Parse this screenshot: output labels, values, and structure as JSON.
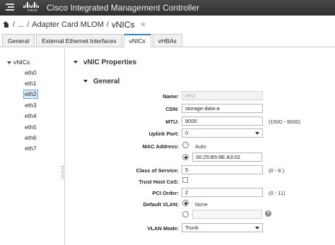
{
  "app": {
    "brand": "cisco",
    "title": "Cisco Integrated Management Controller"
  },
  "breadcrumb": {
    "ellipsis": "...",
    "separator": "/",
    "parent": "Adapter Card MLOM",
    "current": "vNICs"
  },
  "tabs": [
    "General",
    "External Ethernet Interfaces",
    "vNICs",
    "vHBAs"
  ],
  "tree": {
    "root": "vNICs",
    "items": [
      "eth0",
      "eth1",
      "eth2",
      "eth3",
      "eth4",
      "eth5",
      "eth6",
      "eth7"
    ],
    "selected": "eth2"
  },
  "section": {
    "title": "vNIC Properties",
    "subtitle": "General"
  },
  "form": {
    "name": {
      "label": "Name:",
      "value": "eth2"
    },
    "cdn": {
      "label": "CDN:",
      "value": "storage-data-a"
    },
    "mtu": {
      "label": "MTU:",
      "value": "9000",
      "hint": "(1500 - 9000)"
    },
    "uplink_port": {
      "label": "Uplink Port:",
      "value": "0"
    },
    "mac_address": {
      "label": "MAC Address:",
      "auto_label": "Auto",
      "value": "00:25:B5:8E:A3:02"
    },
    "class_of_service": {
      "label": "Class of Service:",
      "value": "5",
      "hint": "(0 - 6 )"
    },
    "trust_host_cos": {
      "label": "Trust Host CoS:",
      "checked": false
    },
    "pci_order": {
      "label": "PCI Order:",
      "value": "2",
      "hint": "(0 - 11)"
    },
    "default_vlan": {
      "label": "Default VLAN:",
      "none_label": "None",
      "value": ""
    },
    "vlan_mode": {
      "label": "VLAN Mode:",
      "value": "Trunk"
    }
  },
  "colors": {
    "accent": "#2a8ad3",
    "topbar": "#3a3a3a",
    "selected_bg": "#d8ecf8"
  },
  "icons": [
    "menu-icon",
    "cisco-logo",
    "home-icon",
    "star-icon",
    "help-icon"
  ]
}
